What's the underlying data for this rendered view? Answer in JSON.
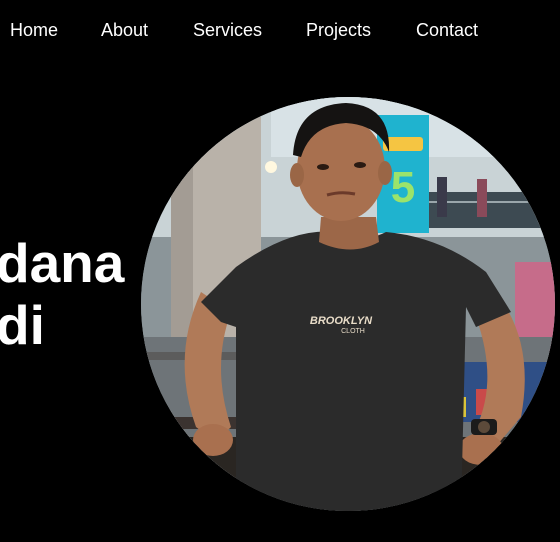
{
  "nav": {
    "items": [
      "Home",
      "About",
      "Services",
      "Projects",
      "Contact"
    ]
  },
  "hero": {
    "name_line1": "dana",
    "name_line2": "di"
  },
  "photo": {
    "shirt_print_line1": "BROOKLYN",
    "shirt_print_line2": "CLOTH",
    "banner_number": "5"
  },
  "colors": {
    "background": "#000000",
    "text": "#ffffff",
    "banner": "#1fb3cf",
    "shirt": "#2b2b2b"
  }
}
